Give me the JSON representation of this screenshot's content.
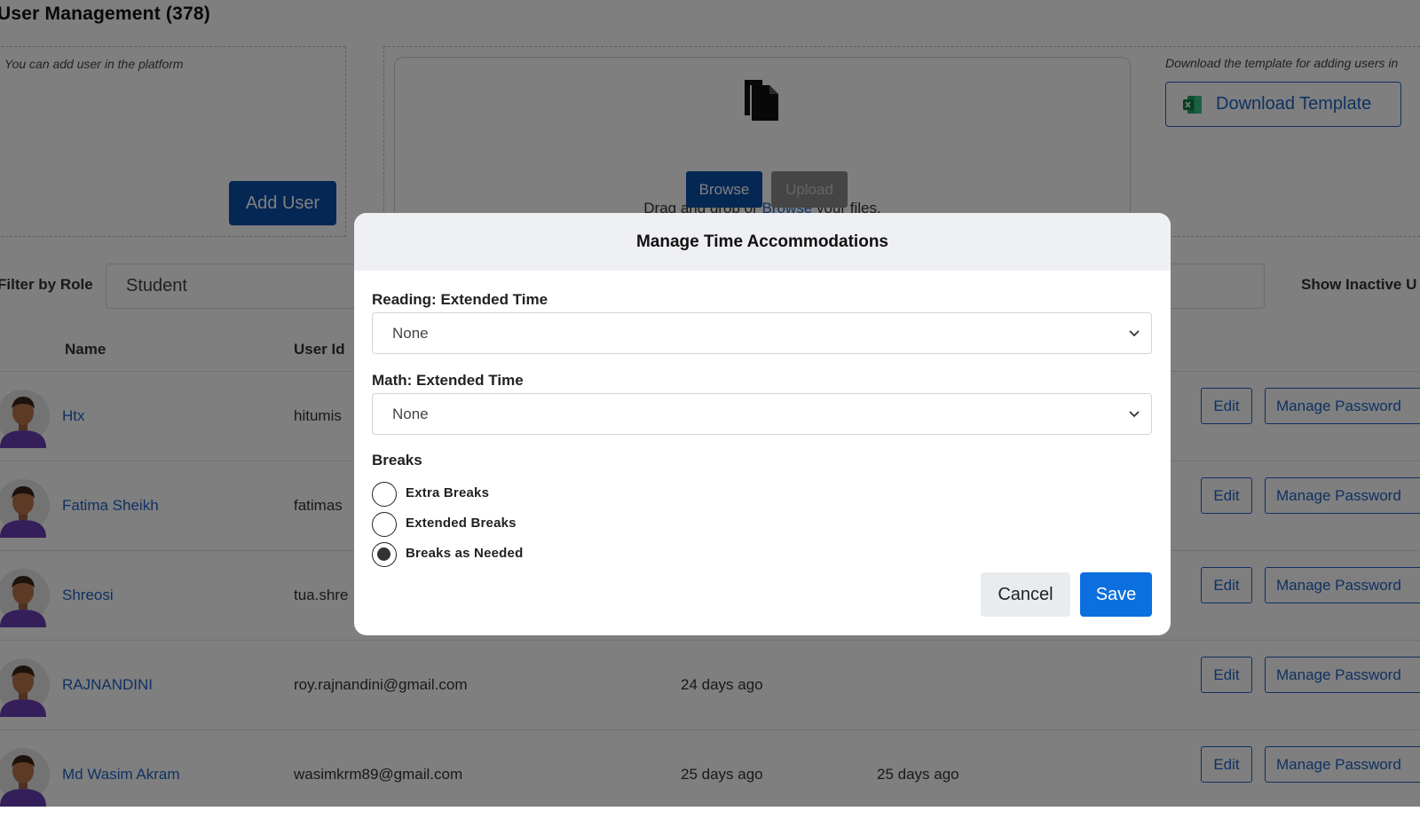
{
  "header": {
    "title": "User Management (378)"
  },
  "add_user_panel": {
    "hint": "You can add user in the platform",
    "button_label": "Add User"
  },
  "upload_panel": {
    "drop_text_before": "Drag and drop or ",
    "drop_link": "Browse",
    "drop_text_after": " your files.",
    "browse_label": "Browse",
    "upload_label": "Upload"
  },
  "template_panel": {
    "hint": "Download the template for adding users in",
    "button_label": "Download Template"
  },
  "filters": {
    "role_label": "Filter by Role",
    "role_value": "Student",
    "show_inactive_label": "Show Inactive U"
  },
  "table": {
    "columns": [
      "Name",
      "User Id"
    ],
    "rows": [
      {
        "name": "Htx",
        "user_id": "hitumis",
        "date1": "",
        "date2": ""
      },
      {
        "name": "Fatima Sheikh",
        "user_id": "fatimas",
        "date1": "",
        "date2": ""
      },
      {
        "name": "Shreosi",
        "user_id": "tua.shre",
        "date1": "",
        "date2": ""
      },
      {
        "name": "RAJNANDINI",
        "user_id": "roy.rajnandini@gmail.com",
        "date1": "24 days ago",
        "date2": ""
      },
      {
        "name": "Md Wasim Akram",
        "user_id": "wasimkrm89@gmail.com",
        "date1": "25 days ago",
        "date2": "25 days ago"
      }
    ],
    "edit_label": "Edit",
    "manage_password_label": "Manage Password"
  },
  "modal": {
    "title": "Manage Time Accommodations",
    "reading_label": "Reading: Extended Time",
    "reading_value": "None",
    "math_label": "Math: Extended Time",
    "math_value": "None",
    "breaks_label": "Breaks",
    "break_options": [
      {
        "label": "Extra Breaks",
        "checked": false
      },
      {
        "label": "Extended Breaks",
        "checked": false
      },
      {
        "label": "Breaks as Needed",
        "checked": true
      }
    ],
    "cancel_label": "Cancel",
    "save_label": "Save"
  },
  "colors": {
    "primary": "#0b4fa8",
    "link": "#1f63c4",
    "save": "#0b6fe0",
    "backdrop": "rgba(0,0,0,0.5)"
  }
}
